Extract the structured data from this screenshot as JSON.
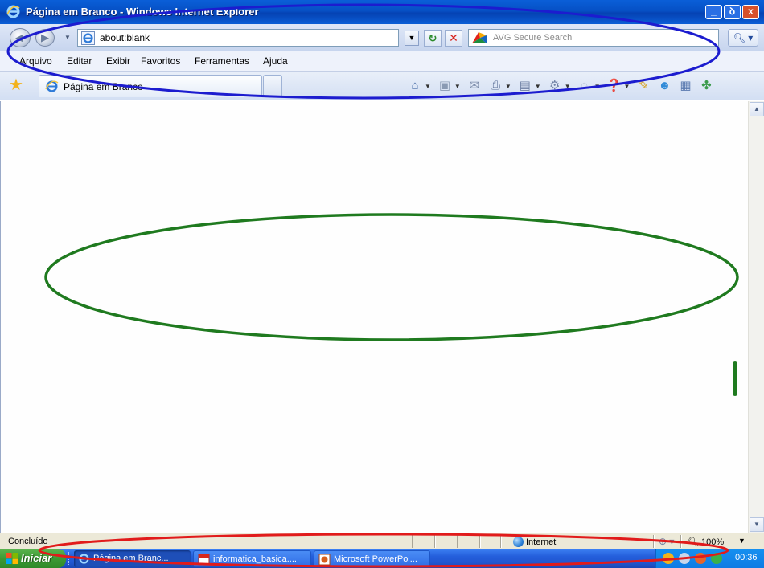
{
  "window": {
    "title": "Página em Branco - Windows Internet Explorer",
    "buttons": {
      "minimize": "_",
      "maximize": "ꝺ",
      "close": "x"
    }
  },
  "address_bar": {
    "url": "about:blank",
    "search_placeholder": "AVG Secure Search",
    "refresh_icon": "refresh-icon",
    "stop_icon": "stop-icon"
  },
  "menu": {
    "items": [
      "Arquivo",
      "Editar",
      "Exibir",
      "Favoritos",
      "Ferramentas",
      "Ajuda"
    ]
  },
  "favorites_bar": {
    "tab_label": "Página em Branco",
    "command_icons": [
      "home-icon",
      "feeds-icon",
      "mail-icon",
      "print-icon",
      "page-icon",
      "tools-icon",
      "research-icon",
      "help-icon",
      "blog-icon",
      "messenger-icon",
      "toolbar-icon",
      "addon-icon"
    ]
  },
  "status_bar": {
    "text": "Concluído",
    "zone": "Internet",
    "zoom": "100%"
  },
  "taskbar": {
    "start_label": "Iniciar",
    "tasks": [
      {
        "label": "Página em Branc...",
        "active": true
      },
      {
        "label": "informatica_basica....",
        "active": false
      },
      {
        "label": "Microsoft PowerPoi...",
        "active": false
      }
    ],
    "clock": "00:36"
  },
  "annotations": {
    "colors": {
      "top": "#1c1ccf",
      "middle": "#1f7a1f",
      "bottom": "#e11b1b"
    }
  }
}
